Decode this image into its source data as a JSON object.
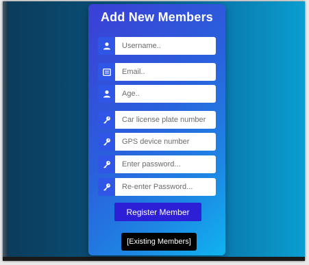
{
  "form": {
    "title": "Add New Members",
    "fields": [
      {
        "name": "username",
        "placeholder": "Username..",
        "icon": "user-icon"
      },
      {
        "name": "email",
        "placeholder": "Email..",
        "icon": "envelope-icon"
      },
      {
        "name": "age",
        "placeholder": "Age..",
        "icon": "user-icon"
      },
      {
        "name": "license-plate",
        "placeholder": "Car license plate number",
        "icon": "key-icon"
      },
      {
        "name": "gps-device",
        "placeholder": "GPS device number",
        "icon": "key-icon"
      },
      {
        "name": "password",
        "placeholder": "Enter password...",
        "icon": "key-icon"
      },
      {
        "name": "password-confirm",
        "placeholder": "Re-enter Password...",
        "icon": "key-icon"
      }
    ],
    "register_label": "Register Member",
    "existing_label": "[Existing Members]"
  },
  "colors": {
    "icon_bg": "#2f56e6",
    "register_bg": "#2c1fd6",
    "existing_bg": "#000000"
  }
}
